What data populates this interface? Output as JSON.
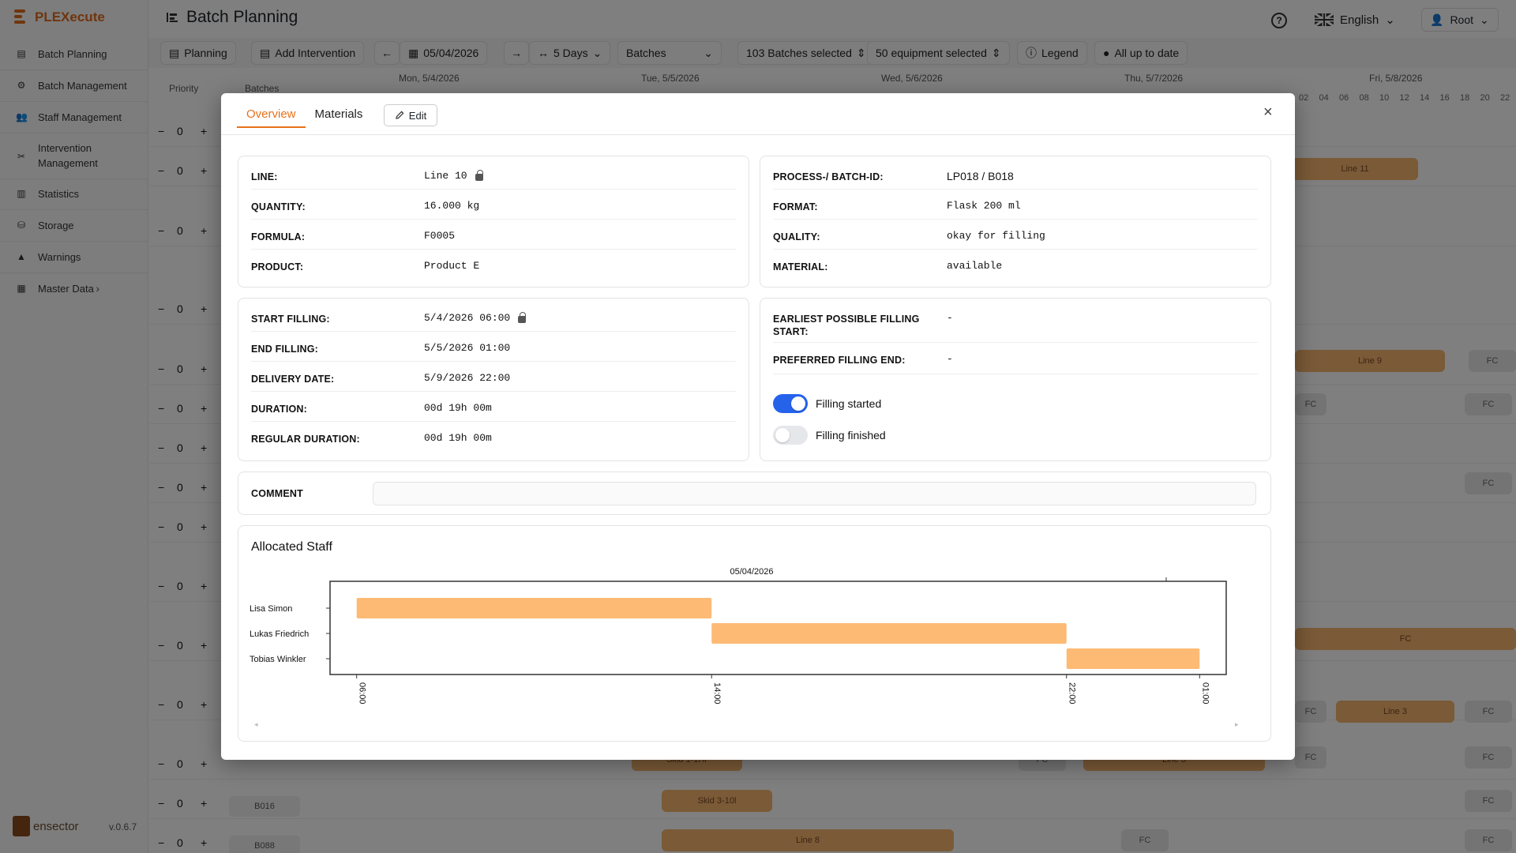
{
  "app": {
    "name": "PLEXecute",
    "version": "v.0.6.7",
    "footer_brand": "ensector"
  },
  "sidebar": {
    "items": [
      {
        "label": "Batch Planning",
        "icon": "chart-icon"
      },
      {
        "label": "Batch Management",
        "icon": "gear-icon"
      },
      {
        "label": "Staff Management",
        "icon": "users-icon"
      },
      {
        "label": "Intervention Management",
        "icon": "tools-icon"
      },
      {
        "label": "Statistics",
        "icon": "bar-chart-icon"
      },
      {
        "label": "Storage",
        "icon": "database-icon"
      },
      {
        "label": "Warnings",
        "icon": "warning-icon"
      },
      {
        "label": "Master Data",
        "icon": "table-icon"
      }
    ]
  },
  "header": {
    "title": "Batch Planning",
    "language": "English",
    "user": "Root"
  },
  "toolbar": {
    "planning": "Planning",
    "add_intervention": "Add Intervention",
    "date": "05/04/2026",
    "range": "5 Days",
    "view": "Batches",
    "batches_selected": "103 Batches selected",
    "equipment_selected": "50 equipment selected",
    "legend": "Legend",
    "status": "All up to date"
  },
  "grid": {
    "priority_header": "Priority",
    "batches_header": "Batches",
    "days": [
      "Mon, 5/4/2026",
      "Tue, 5/5/2026",
      "Wed, 5/6/2026",
      "Thu, 5/7/2026",
      "Fri, 5/8/2026"
    ],
    "hours": [
      "02",
      "04",
      "06",
      "08",
      "10",
      "12",
      "14",
      "16",
      "18",
      "20",
      "22"
    ],
    "priority_value": "0",
    "minus": "−",
    "plus": "+",
    "batch_labels": [
      "B016",
      "B088"
    ],
    "blocks": [
      "Line 11",
      "Line 9",
      "FC",
      "FC",
      "FC",
      "FC",
      "FC",
      "FC",
      "Line 3",
      "FC",
      "FC",
      "Skid 1-1Hr",
      "FC",
      "Line 3",
      "FC",
      "FC",
      "Skid 3-10l",
      "FC",
      "Line 8",
      "FC"
    ]
  },
  "modal": {
    "tabs": [
      "Overview",
      "Materials"
    ],
    "edit_label": "Edit",
    "close_label": "×",
    "card1": [
      {
        "label": "LINE:",
        "value": "Line 10",
        "locked": true
      },
      {
        "label": "QUANTITY:",
        "value": "16.000 kg"
      },
      {
        "label": "FORMULA:",
        "value": "F0005"
      },
      {
        "label": "PRODUCT:",
        "value": "Product E"
      }
    ],
    "card2": [
      {
        "label": "PROCESS-/ BATCH-ID:",
        "value": "LP018 / B018"
      },
      {
        "label": "FORMAT:",
        "value": "Flask 200 ml"
      },
      {
        "label": "QUALITY:",
        "value": "okay for filling"
      },
      {
        "label": "MATERIAL:",
        "value": "available"
      }
    ],
    "card3": [
      {
        "label": "START FILLING:",
        "value": "5/4/2026 06:00",
        "locked": true
      },
      {
        "label": "END FILLING:",
        "value": "5/5/2026 01:00"
      },
      {
        "label": "DELIVERY DATE:",
        "value": "5/9/2026 22:00"
      },
      {
        "label": "DURATION:",
        "value": "00d 19h 00m"
      },
      {
        "label": "REGULAR DURATION:",
        "value": "00d 19h 00m"
      }
    ],
    "card4": {
      "earliest_label": "EARLIEST POSSIBLE FILLING START:",
      "earliest_value": "-",
      "preferred_label": "PREFERRED FILLING END:",
      "preferred_value": "-",
      "toggles": [
        {
          "label": "Filling started",
          "on": true
        },
        {
          "label": "Filling finished",
          "on": false
        }
      ]
    },
    "comment": {
      "label": "COMMENT",
      "value": ""
    },
    "allocated_staff": {
      "title": "Allocated Staff"
    }
  },
  "chart_data": {
    "type": "gantt",
    "title": "05/04/2026",
    "x_ticks": [
      "06:00",
      "14:00",
      "22:00",
      "01:00"
    ],
    "x_range_hours": [
      5.4,
      25.6
    ],
    "series": [
      {
        "name": "Lisa Simon",
        "start": 6,
        "end": 14
      },
      {
        "name": "Lukas Friedrich",
        "start": 14,
        "end": 22
      },
      {
        "name": "Tobias Winkler",
        "start": 22,
        "end": 25
      }
    ],
    "bar_color": "#fdba74"
  },
  "colors": {
    "accent": "#e8711a",
    "toggle_on": "#2563eb"
  }
}
